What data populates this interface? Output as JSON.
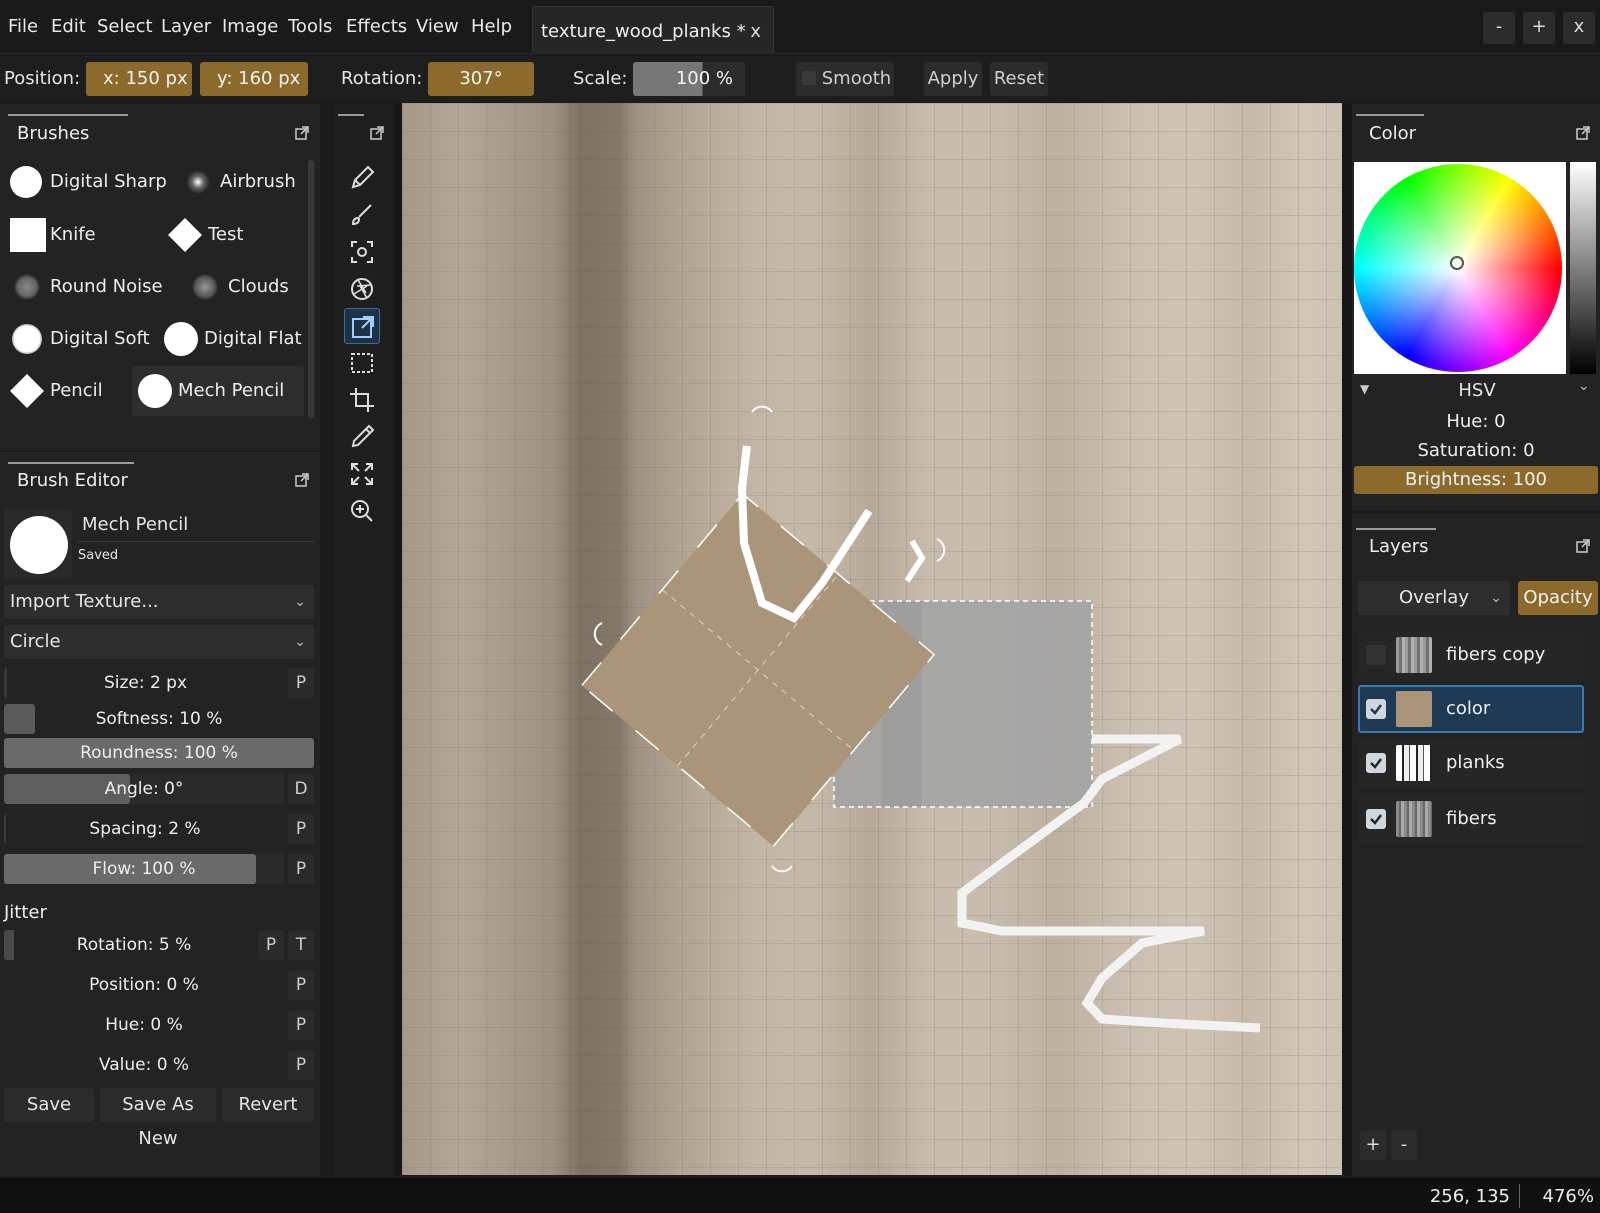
{
  "menubar": {
    "items": [
      "File",
      "Edit",
      "Select",
      "Layer",
      "Image",
      "Tools",
      "Effects",
      "View",
      "Help"
    ],
    "tab_title": "texture_wood_planks *",
    "tab_close": "x",
    "win_min": "-",
    "win_max": "+",
    "win_close": "x"
  },
  "toolbar": {
    "position_label": "Position:",
    "x_value": "x: 150 px",
    "y_value": "y: 160 px",
    "rotation_label": "Rotation:",
    "rotation_value": "307°",
    "scale_label": "Scale:",
    "scale_value": "100 %",
    "smooth_label": "Smooth",
    "apply_label": "Apply",
    "reset_label": "Reset"
  },
  "brushes": {
    "title": "Brushes",
    "items": [
      "Digital Sharp",
      "Airbrush",
      "Knife",
      "Test",
      "Round Noise",
      "Clouds",
      "Digital Soft",
      "Digital Flat",
      "Pencil",
      "Mech Pencil"
    ],
    "selected": "Mech Pencil"
  },
  "brush_editor": {
    "title": "Brush Editor",
    "brush_name": "Mech Pencil",
    "status": "Saved",
    "texture_dropdown": "Import Texture...",
    "shape_dropdown": "Circle",
    "size": "Size: 2 px",
    "softness": "Softness: 10 %",
    "roundness": "Roundness: 100 %",
    "angle": "Angle: 0°",
    "spacing": "Spacing: 2 %",
    "flow": "Flow: 100 %",
    "jitter_title": "Jitter",
    "jitter_rotation": "Rotation: 5 %",
    "jitter_position": "Position: 0 %",
    "jitter_hue": "Hue: 0 %",
    "jitter_value": "Value: 0 %",
    "p": "P",
    "d": "D",
    "t": "T",
    "softness_level": 0.1,
    "angle_level": 0.45,
    "flow_level": 0.9,
    "save_label": "Save",
    "save_as_new_label": "Save As New",
    "revert_label": "Revert"
  },
  "tools": [
    "pencil-icon",
    "brush-icon",
    "transform-capture-icon",
    "aperture-icon",
    "move-transform-icon",
    "rect-select-icon",
    "crop-icon",
    "eyedropper-icon",
    "fit-screen-icon",
    "zoom-icon"
  ],
  "color": {
    "title": "Color",
    "mode": "HSV",
    "hue": "Hue: 0",
    "saturation": "Saturation: 0",
    "brightness": "Brightness: 100"
  },
  "layers": {
    "title": "Layers",
    "blend_mode": "Overlay",
    "opacity_label": "Opacity",
    "items": [
      {
        "name": "fibers copy",
        "visible": false
      },
      {
        "name": "color",
        "visible": true,
        "selected": true
      },
      {
        "name": "planks",
        "visible": true
      },
      {
        "name": "fibers",
        "visible": true
      }
    ],
    "add_label": "+",
    "remove_label": "-"
  },
  "status": {
    "coords": "256, 135",
    "zoom": "476%"
  },
  "colors": {
    "accent_gold": "#8b6a2c",
    "panel_bg": "#232323",
    "selection_blue": "#1f3a55"
  }
}
